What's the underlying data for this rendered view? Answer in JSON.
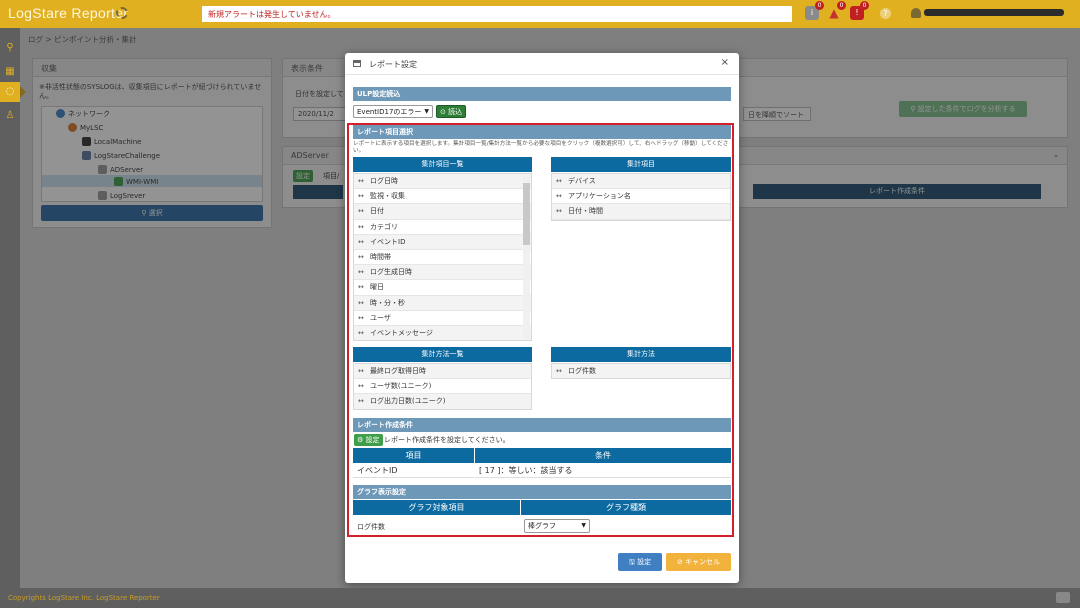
{
  "header": {
    "brand": "LogStare Reporter",
    "alert": "新規アラートは発生していません。",
    "badge_counts": [
      "0",
      "0",
      "0"
    ],
    "help_icon": "?"
  },
  "sidebar": {
    "icons": [
      "search-icon",
      "report-icon",
      "chat-icon",
      "user-icon"
    ]
  },
  "breadcrumb": "ログ > ピンポイント分析・集計",
  "collect_panel": {
    "title": "収集",
    "note": "※非活性状態のSYSLOGは、収集項目にレポートが紐づけられていません。",
    "tree": [
      "ネットワーク",
      "MyLSC",
      "LocalMachine",
      "LogStareChallenge",
      "ADServer",
      "WMI-WMI",
      "LogSrever"
    ],
    "select_button": "選択"
  },
  "display_panel": {
    "title": "表示条件",
    "date_label": "日付を設定して",
    "date_value": "2020/11/2",
    "sort_value": "日を降順でソート",
    "analyze_button": "設定した条件でログを分析する"
  },
  "ad_panel": {
    "title": "ADServer",
    "settings_btn": "設定",
    "items_label": "項目/",
    "report_condition_bar": "レポート作成条件"
  },
  "modal": {
    "title": "レポート設定",
    "close": "×",
    "ulp_section": "ULP設定読込",
    "ulp_select": "EventID17のエラー",
    "load_button": "読込",
    "report_item_section": "レポート項目選択",
    "description": "レポートに表示する項目を選択します。集計項目一覧/集計方法一覧から必要な項目をクリック（複数選択可）して、右へドラッグ（移動）してください。",
    "agg_items_list_header": "集計項目一覧",
    "agg_items_header": "集計項目",
    "agg_items_list": [
      "ログ日時",
      "監視・収集",
      "日付",
      "カテゴリ",
      "イベントID",
      "時間帯",
      "ログ生成日時",
      "曜日",
      "時・分・秒",
      "ユーザ",
      "イベントメッセージ"
    ],
    "agg_items": [
      "デバイス",
      "アプリケーション名",
      "日付・時間"
    ],
    "agg_method_list_header": "集計方法一覧",
    "agg_method_header": "集計方法",
    "agg_method_list": [
      "最終ログ取得日時",
      "ユーザ数(ユニーク)",
      "ログ出力日数(ユニーク)"
    ],
    "agg_method": [
      "ログ件数"
    ],
    "condition_section": "レポート作成条件",
    "condition_btn": "設定",
    "condition_hint": "レポート作成条件を設定してください。",
    "cond_headers": [
      "項目",
      "条件"
    ],
    "cond_rows": [
      [
        "イベントID",
        "[ 17 ]：等しい：該当する"
      ]
    ],
    "graph_section": "グラフ表示設定",
    "graph_headers": [
      "グラフ対象項目",
      "グラフ種類"
    ],
    "graph_row_item": "ログ件数",
    "graph_type": "棒グラフ",
    "save_button": "設定",
    "cancel_button": "キャンセル"
  },
  "footer": {
    "copyright": "Copyrights LogStare Inc.   LogStare Reporter"
  },
  "colors": {
    "header": "#e0b021",
    "primary": "#0c6aa0",
    "section": "#6e98b8",
    "highlight": "#d4202a",
    "cancel": "#f2b33c"
  }
}
